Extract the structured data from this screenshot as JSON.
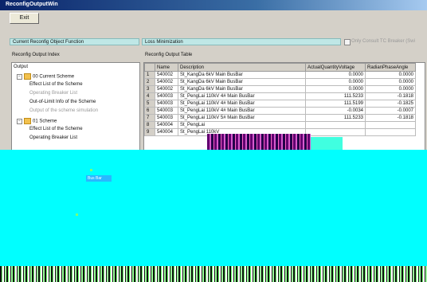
{
  "window": {
    "title": "ReconfigOutputWin"
  },
  "toolbar": {
    "exit_label": "Exit"
  },
  "objective": {
    "label": "Current Reconfig  Object Function",
    "value": "Loss Minimization",
    "checkbox_label": "Only Consult TC  Breaker (Swi"
  },
  "tree": {
    "title": "Reconfig Output Index",
    "root": "Output",
    "nodes": [
      {
        "label": "00 Current Scheme",
        "type": "folder"
      },
      {
        "label": "Effect List of the Scheme",
        "type": "leaf"
      },
      {
        "label": "Operating Breaker List",
        "type": "leaf-gray"
      },
      {
        "label": "Out-of-Limit Info of the Scheme",
        "type": "leaf"
      },
      {
        "label": "Output of the scheme simulation",
        "type": "leaf-gray"
      },
      {
        "label": "01 Scheme",
        "type": "folder"
      },
      {
        "label": "Effect List of the Scheme",
        "type": "leaf"
      },
      {
        "label": "Operating Breaker List",
        "type": "leaf"
      }
    ]
  },
  "table": {
    "title": "Reconfig Output Table",
    "columns": [
      "",
      "Name",
      "Description",
      "ActualQuantityVoltage",
      "RadianPhaseAngle"
    ],
    "rows": [
      [
        "1",
        "540002",
        "St_KangDa 6kV Main BusBar",
        "0.0000",
        "0.0000"
      ],
      [
        "2",
        "540002",
        "St_KangDa 6kV Main BusBar",
        "0.0000",
        "0.0000"
      ],
      [
        "3",
        "540002",
        "St_KangDa 6kV Main BusBar",
        "0.0000",
        "0.0000"
      ],
      [
        "4",
        "540003",
        "St_PengLai 110kV 4# Main BusBar",
        "111.5233",
        "-0.1818"
      ],
      [
        "5",
        "540003",
        "St_PengLai 110kV 4# Main BusBar",
        "111.5199",
        "-0.1825"
      ],
      [
        "6",
        "540003",
        "St_PengLai 110kV 4# Main BusBar",
        "-0.0034",
        "-0.0007"
      ],
      [
        "7",
        "540003",
        "St_PengLai 110kV 5# Main BusBar",
        "111.5233",
        "-0.1818"
      ],
      [
        "8",
        "540004",
        "St_PengLai",
        "",
        ""
      ],
      [
        "9",
        "540004",
        "St_PengLai 110kV",
        "",
        ""
      ]
    ]
  },
  "overlay": {
    "selected_text": "Bus Bar"
  }
}
